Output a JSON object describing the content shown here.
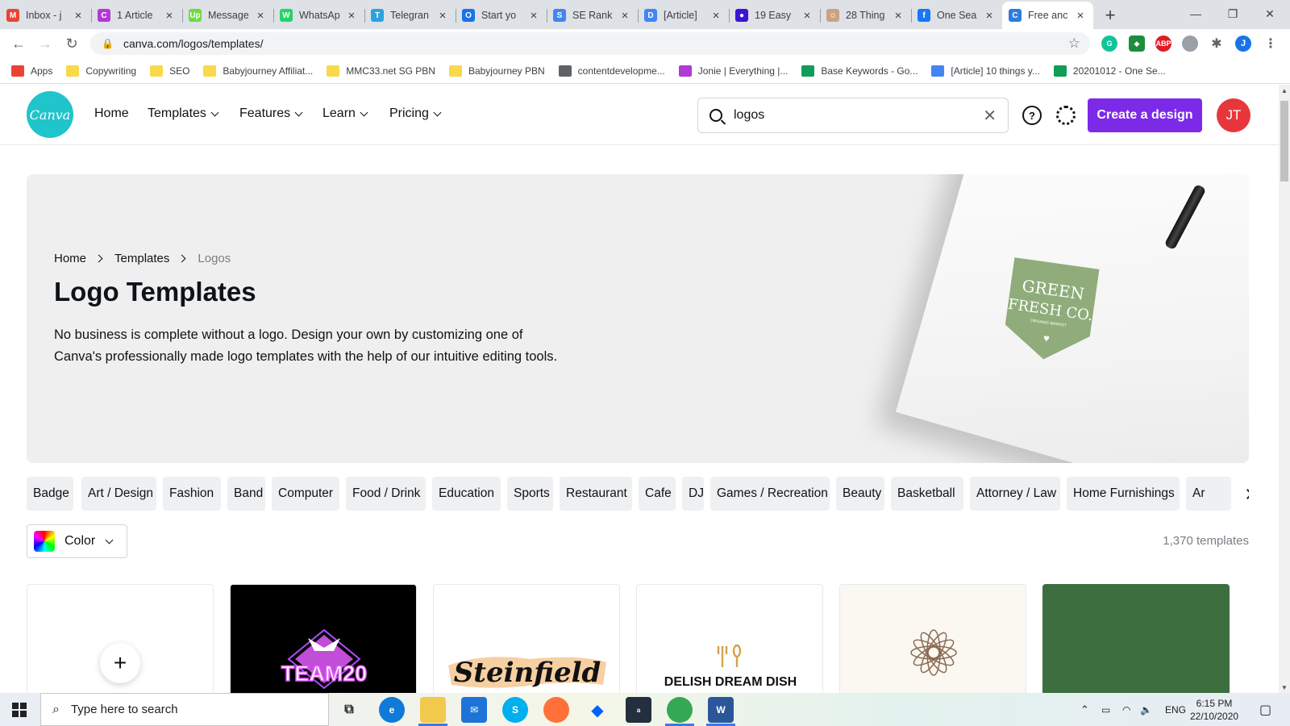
{
  "browser": {
    "tabs": [
      {
        "title": "Inbox - j",
        "color": "#ea4335",
        "glyph": "M"
      },
      {
        "title": "1 Article",
        "color": "#b03bd6",
        "glyph": "C"
      },
      {
        "title": "Message",
        "color": "#6fda44",
        "glyph": "Up"
      },
      {
        "title": "WhatsAp",
        "color": "#25d366",
        "glyph": "W"
      },
      {
        "title": "Telegran",
        "color": "#2aa3e0",
        "glyph": "T"
      },
      {
        "title": "Start yo",
        "color": "#1a73e8",
        "glyph": "O"
      },
      {
        "title": "SE Rank",
        "color": "#4285f4",
        "glyph": "S"
      },
      {
        "title": "[Article]",
        "color": "#4285f4",
        "glyph": "D"
      },
      {
        "title": "19 Easy",
        "color": "#3b14d8",
        "glyph": "●"
      },
      {
        "title": "28 Thing",
        "color": "#c9a27e",
        "glyph": "☺"
      },
      {
        "title": "One Sea",
        "color": "#1877f2",
        "glyph": "f"
      },
      {
        "title": "Free anc",
        "color": "#2f7be0",
        "glyph": "C"
      }
    ],
    "new_tab": "+",
    "url": "canva.com/logos/templates/",
    "bookmarks": [
      {
        "label": "Apps",
        "color": "#ea4335"
      },
      {
        "label": "Copywriting",
        "color": "#f9d94a"
      },
      {
        "label": "SEO",
        "color": "#f9d94a"
      },
      {
        "label": "Babyjourney Affiliat...",
        "color": "#f9d94a"
      },
      {
        "label": "MMC33.net SG PBN",
        "color": "#f9d94a"
      },
      {
        "label": "Babyjourney PBN",
        "color": "#f9d94a"
      },
      {
        "label": "contentdevelopme...",
        "color": "#5f6368"
      },
      {
        "label": "Jonie | Everything |...",
        "color": "#b03bd6"
      },
      {
        "label": "Base Keywords - Go...",
        "color": "#0f9d58"
      },
      {
        "label": "[Article] 10 things y...",
        "color": "#4285f4"
      },
      {
        "label": "20201012 - One Se...",
        "color": "#0f9d58"
      }
    ],
    "profile_initial": "J"
  },
  "header": {
    "logo_text": "Canva",
    "nav": {
      "home": "Home",
      "templates": "Templates",
      "features": "Features",
      "learn": "Learn",
      "pricing": "Pricing"
    },
    "search_value": "logos",
    "help_glyph": "?",
    "create_button": "Create a design",
    "avatar_initials": "JT"
  },
  "hero": {
    "breadcrumb": {
      "home": "Home",
      "templates": "Templates",
      "current": "Logos"
    },
    "title": "Logo Templates",
    "description": "No business is complete without a logo. Design your own by customizing one of Canva's professionally made logo templates with the help of our intuitive editing tools.",
    "mockup_logo": {
      "line1": "GREEN",
      "line2": "FRESH CO.",
      "tagline": "ORGANIC MARKET",
      "color": "#8fac7a"
    }
  },
  "categories": [
    "Badge",
    "Art / Design",
    "Fashion",
    "Band",
    "Computer",
    "Food / Drink",
    "Education",
    "Sports",
    "Restaurant",
    "Cafe",
    "DJ",
    "Games / Recreation",
    "Beauty",
    "Basketball",
    "Attorney / Law",
    "Home Furnishings",
    "Ar"
  ],
  "filters": {
    "color_label": "Color",
    "template_count": "1,370 templates"
  },
  "cards": [
    {
      "type": "create",
      "glyph": "+"
    },
    {
      "type": "template",
      "text": "TEAM20",
      "bg": "#000000"
    },
    {
      "type": "template",
      "text": "Steinfield",
      "bg": "#ffffff"
    },
    {
      "type": "template",
      "text": "DELISH DREAM DISH",
      "bg": "#ffffff"
    },
    {
      "type": "template",
      "text": "",
      "bg": "#fbf7f1"
    },
    {
      "type": "template",
      "text": "",
      "bg": "#3c6e40"
    }
  ],
  "taskbar": {
    "search_placeholder": "Type here to search",
    "language": "ENG",
    "time": "6:15 PM",
    "date": "22/10/2020"
  }
}
